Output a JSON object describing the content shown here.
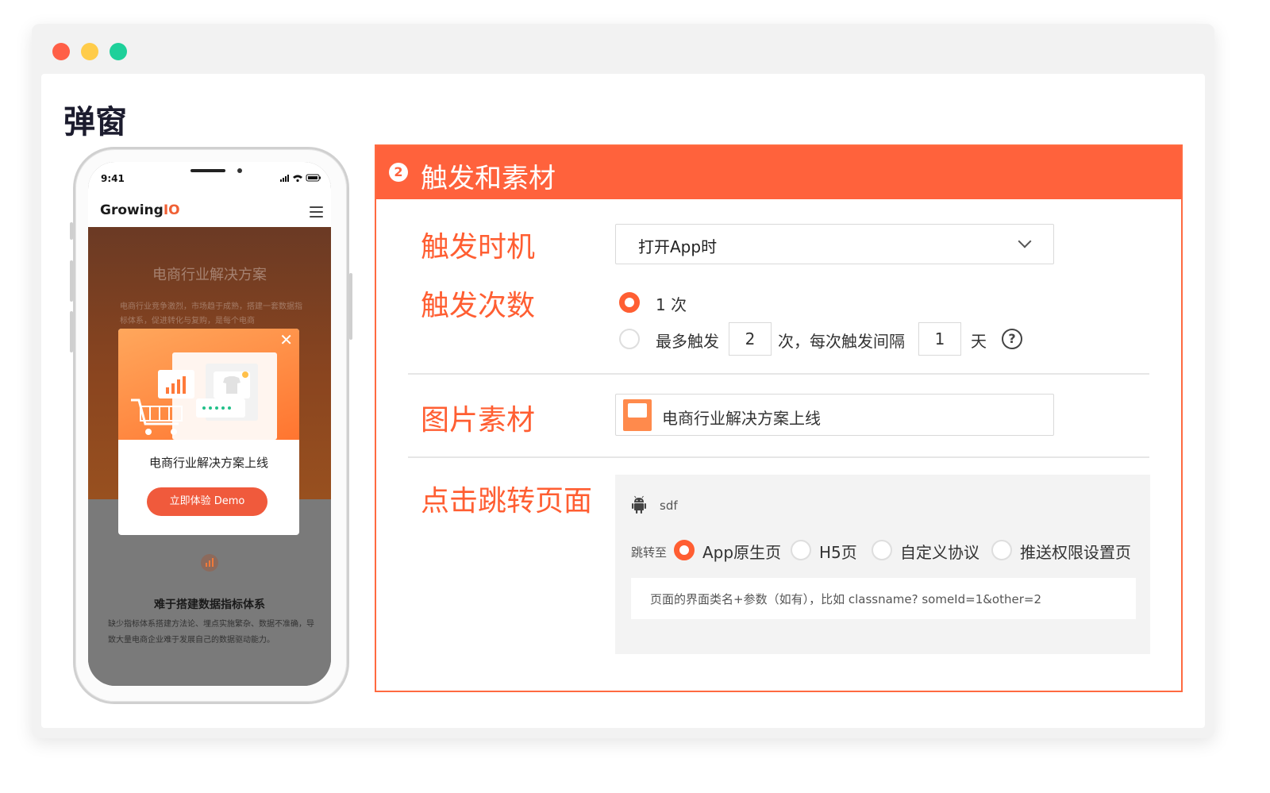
{
  "window": {
    "dots": [
      "#ff5f47",
      "#ffcc4a",
      "#1ed09a"
    ]
  },
  "page": {
    "title": "弹窗"
  },
  "phone": {
    "time": "9:41",
    "brand": {
      "main": "Growing",
      "accent": "IO"
    },
    "banner_title": "电商行业解决方案",
    "banner_desc": "电商行业竞争激烈，市场趋于成熟，搭建一套数据指标体系，促进转化与复购，是每个电商",
    "popup": {
      "title": "电商行业解决方案上线",
      "button": "立即体验 Demo"
    },
    "below_title": "难于搭建数据指标体系",
    "below_desc": "缺少指标体系搭建方法论、埋点实施繁杂、数据不准确，导致大量电商企业难于发展自己的数据驱动能力。"
  },
  "panel": {
    "step": "2",
    "title": "触发和素材",
    "trigger_time": {
      "label": "触发时机",
      "value": "打开App时"
    },
    "trigger_count": {
      "label": "触发次数",
      "option1": "1 次",
      "option2_prefix": "最多触发",
      "max_times": "2",
      "option2_mid": "次，每次触发间隔",
      "interval": "1",
      "option2_suffix": "天",
      "help": "?"
    },
    "material": {
      "label": "图片素材",
      "name": "电商行业解决方案上线"
    },
    "jump": {
      "label": "点击跳转页面",
      "app_name": "sdf",
      "jump_to": "跳转至",
      "options": [
        "App原生页",
        "H5页",
        "自定义协议",
        "推送权限设置页"
      ],
      "path_placeholder": "页面的界面类名+参数（如有），比如 classname? someId=1&other=2"
    }
  },
  "colors": {
    "accent": "#ff623c",
    "label": "#ff5e32"
  }
}
